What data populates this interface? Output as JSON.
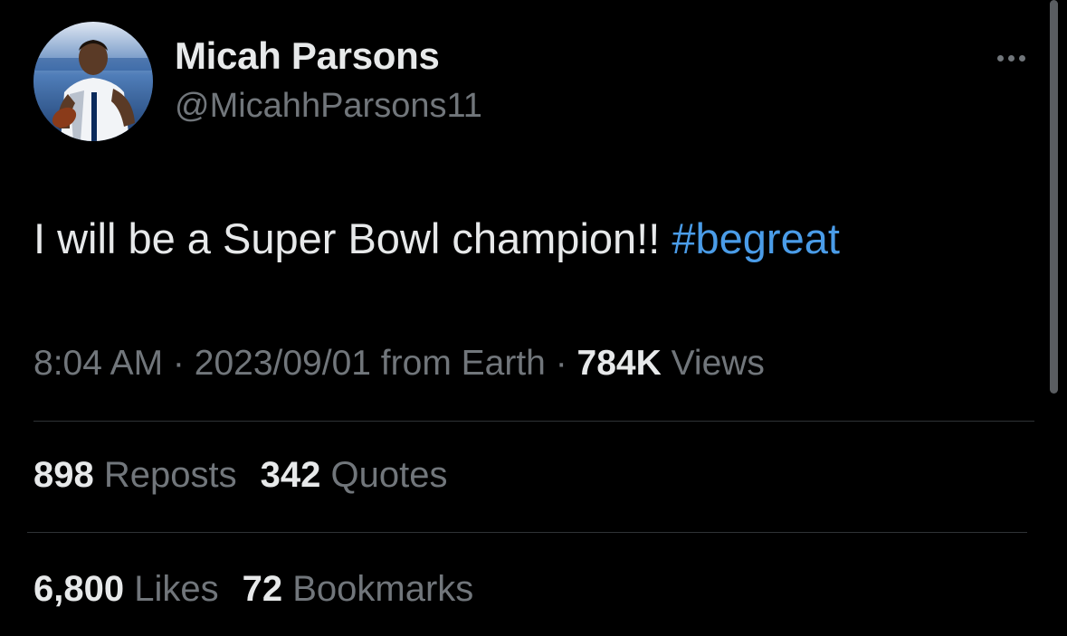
{
  "author": {
    "name": "Micah Parsons",
    "handle": "@MicahhParsons11"
  },
  "tweet": {
    "text": "I will be a Super Bowl champion!! ",
    "hashtag": "#begreat",
    "time": "8:04 AM",
    "separator": " · ",
    "date": "2023/09/01",
    "source": " from Earth",
    "views_count": "784K",
    "views_label": " Views"
  },
  "stats": {
    "reposts": {
      "count": "898",
      "label": " Reposts"
    },
    "quotes": {
      "count": "342",
      "label": " Quotes"
    },
    "likes": {
      "count": "6,800",
      "label": " Likes"
    },
    "bookmarks": {
      "count": "72",
      "label": " Bookmarks"
    }
  },
  "colors": {
    "background": "#000000",
    "primary_text": "#e7e9ea",
    "secondary_text": "#71767b",
    "link": "#4a9ce8",
    "divider": "#2f3336"
  },
  "icons": {
    "more": "more-horizontal-icon"
  }
}
